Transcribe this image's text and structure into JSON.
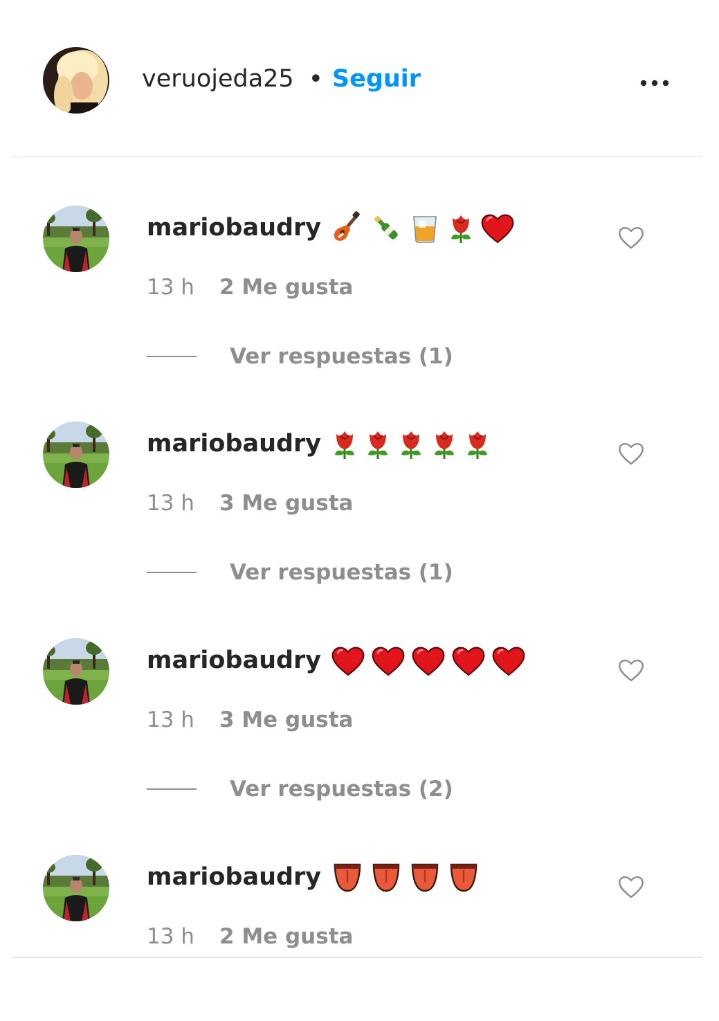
{
  "post_header": {
    "username": "veruojeda25",
    "separator": "•",
    "follow_label": "Seguir",
    "more_icon": "more-horizontal-icon"
  },
  "colors": {
    "link_blue": "#0095f6",
    "text_primary": "#262626",
    "text_secondary": "#8e8e8e",
    "divider": "#efefef"
  },
  "comments": [
    {
      "username": "mariobaudry",
      "emojis": [
        "guitar",
        "champagne-bottle",
        "whisky-glass",
        "rose",
        "red-heart"
      ],
      "time": "13 h",
      "likes": "2 Me gusta",
      "replies_label": "Ver respuestas (1)"
    },
    {
      "username": "mariobaudry",
      "emojis": [
        "rose",
        "rose",
        "rose",
        "rose",
        "rose"
      ],
      "time": "13 h",
      "likes": "3 Me gusta",
      "replies_label": "Ver respuestas (1)"
    },
    {
      "username": "mariobaudry",
      "emojis": [
        "red-heart",
        "red-heart",
        "red-heart",
        "red-heart",
        "red-heart"
      ],
      "time": "13 h",
      "likes": "3 Me gusta",
      "replies_label": "Ver respuestas (2)"
    },
    {
      "username": "mariobaudry",
      "emojis": [
        "tongue",
        "tongue",
        "tongue",
        "tongue"
      ],
      "time": "13 h",
      "likes": "2 Me gusta",
      "replies_label": ""
    }
  ]
}
